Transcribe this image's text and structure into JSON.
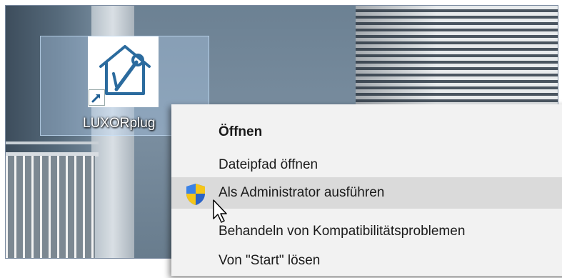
{
  "desktop": {
    "shortcut": {
      "label": "LUXORplug",
      "icon": "house-wrench-icon",
      "overlay_icon": "shortcut-arrow-icon"
    }
  },
  "context_menu": {
    "items": [
      {
        "label": "Öffnen",
        "bold": true
      },
      {
        "label": "Dateipfad öffnen"
      },
      {
        "label": "Als Administrator ausführen",
        "icon": "uac-shield-icon",
        "highlighted": true
      },
      {
        "label": "Behandeln von Kompatibilitätsproblemen"
      },
      {
        "label": "Von \"Start\" lösen"
      }
    ]
  },
  "colors": {
    "menu_background": "#f2f2f2",
    "menu_highlight": "#dadada",
    "icon_blue": "#2b6b9e"
  }
}
